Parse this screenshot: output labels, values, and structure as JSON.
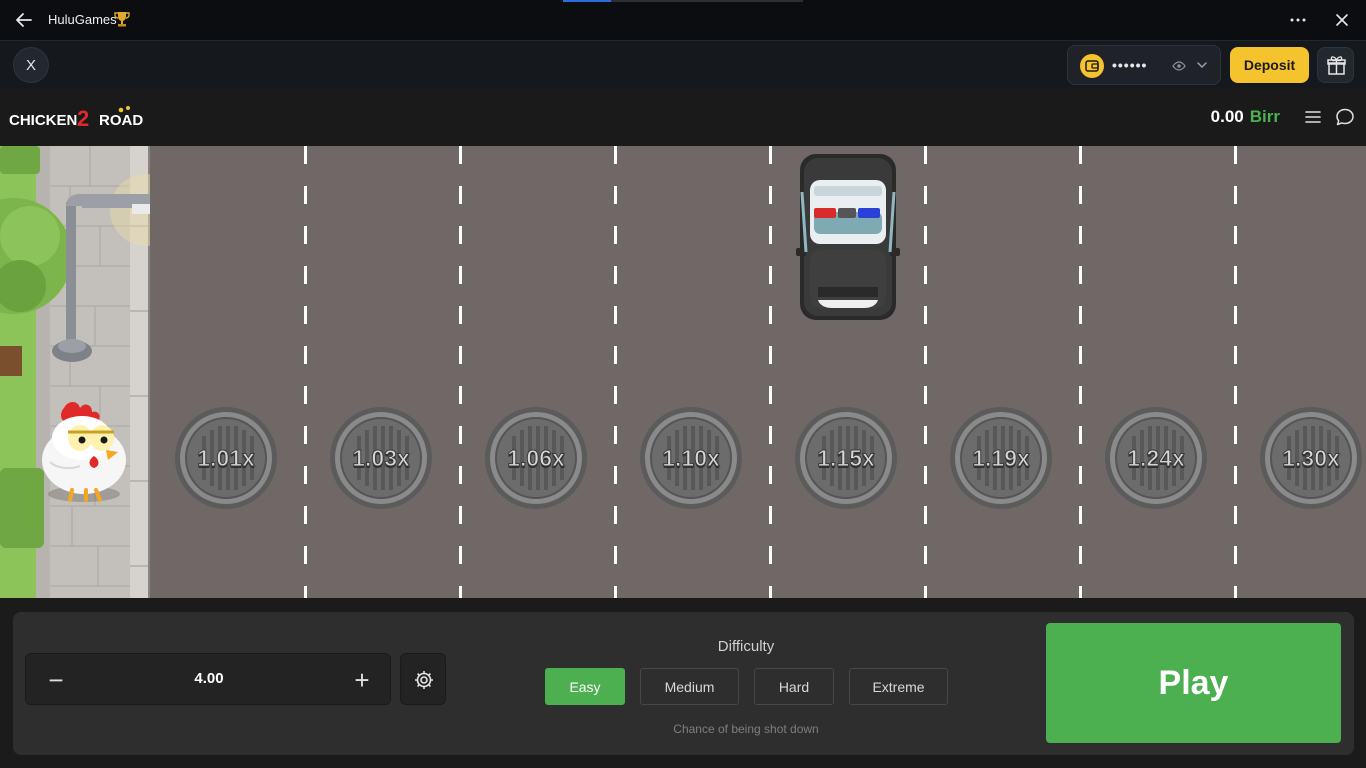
{
  "window": {
    "title": "HuluGames",
    "title_icon": "trophy-icon"
  },
  "casino_header": {
    "close_label": "X",
    "wallet_mask": "••••••",
    "deposit_label": "Deposit"
  },
  "game": {
    "logo_text": "CHICKEN ROAD",
    "logo_number": "2",
    "balance_amount": "0.00",
    "balance_currency": "Birr",
    "multipliers": [
      "1.01x",
      "1.03x",
      "1.06x",
      "1.10x",
      "1.15x",
      "1.19x",
      "1.24x",
      "1.30x"
    ]
  },
  "controls": {
    "stake_value": "4.00",
    "minus_label": "−",
    "plus_label": "+",
    "difficulty_title": "Difficulty",
    "difficulty_options": [
      "Easy",
      "Medium",
      "Hard",
      "Extreme"
    ],
    "difficulty_selected": "Easy",
    "difficulty_note": "Chance of being shot down",
    "play_label": "Play"
  },
  "colors": {
    "accent_green": "#4caf50",
    "deposit_yellow": "#f5c32e",
    "road": "#706866"
  }
}
